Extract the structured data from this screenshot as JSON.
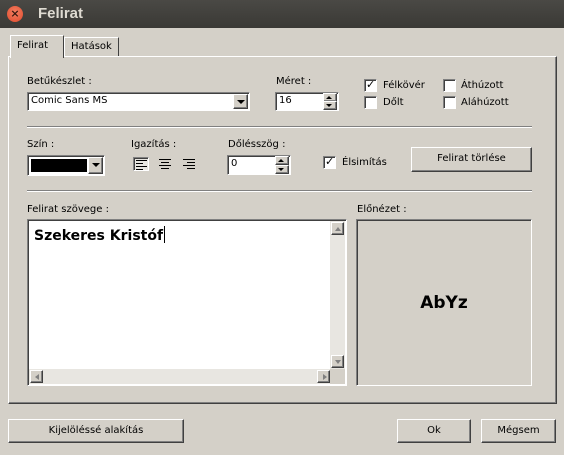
{
  "window": {
    "title": "Felirat",
    "close_glyph": "×"
  },
  "tabs": [
    {
      "label": "Felirat",
      "active": true
    },
    {
      "label": "Hatások",
      "active": false
    }
  ],
  "font": {
    "label": "Betűkészlet :",
    "value": "Comic Sans MS"
  },
  "size": {
    "label": "Méret :",
    "value": "16"
  },
  "style_options": {
    "bold": {
      "label": "Félkövér",
      "checked": true
    },
    "italic": {
      "label": "Dőlt",
      "checked": false
    },
    "strike": {
      "label": "Áthúzott",
      "checked": false
    },
    "underline": {
      "label": "Aláhúzott",
      "checked": false
    }
  },
  "color": {
    "label": "Szín :",
    "value_hex": "#000000"
  },
  "alignment": {
    "label": "Igazítás :",
    "options": [
      "left",
      "center",
      "right"
    ]
  },
  "angle": {
    "label": "Dőlésszög :",
    "value": "0"
  },
  "antialias": {
    "label": "Élsimítás",
    "checked": true
  },
  "buttons": {
    "delete_caption": "Felirat törlése",
    "convert_selection": "Kijelöléssé alakítás",
    "ok": "Ok",
    "cancel": "Mégsem"
  },
  "caption_text": {
    "label": "Felirat szövege :",
    "value": "Szekeres Kristóf"
  },
  "preview": {
    "label": "Előnézet :",
    "sample": "AbYz"
  },
  "colors": {
    "titlebar": "#3c3b37",
    "face": "#d4d0c8",
    "close": "#e8593c"
  }
}
